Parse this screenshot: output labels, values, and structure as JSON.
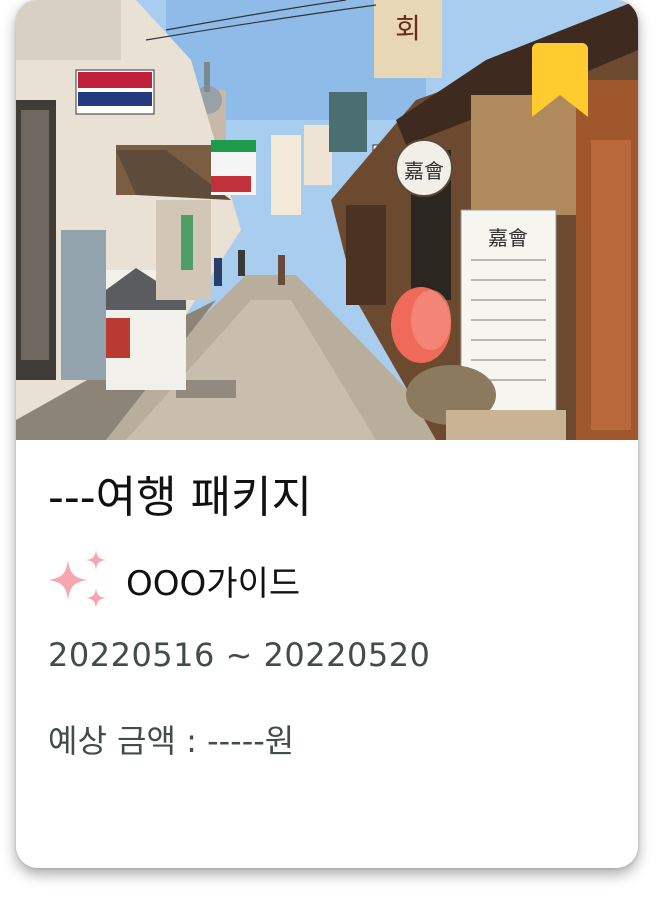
{
  "package": {
    "title": "---여행 패키지",
    "guide": "OOO가이드",
    "dates": "20220516 ~ 20220520",
    "price_label": "예상 금액 :",
    "price_value": "-----원",
    "bookmark_icon": "bookmark-icon",
    "guide_icon": "sparkle-icon",
    "photo_signs": {
      "hoe": "회",
      "gahoe": "嘉會",
      "sign_gahoe_upper": "嘉會"
    }
  },
  "colors": {
    "bookmark": "#FFCB2E",
    "sparkle": "#F7A6AE",
    "title_text": "#111111",
    "secondary_text": "#444C4A"
  }
}
